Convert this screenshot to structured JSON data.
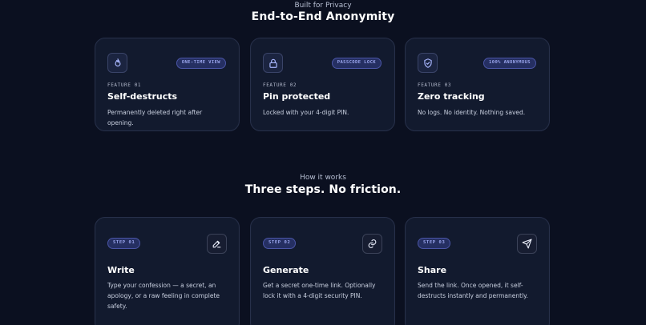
{
  "section1": {
    "eyebrow": "Built for Privacy",
    "title": "End-to-End Anonymity",
    "features": [
      {
        "icon": "flame-icon",
        "badge": "ONE-TIME VIEW",
        "label": "FEATURE 01",
        "title": "Self-destructs",
        "description": "Permanently deleted right after opening."
      },
      {
        "icon": "lock-icon",
        "badge": "PASSCODE LOCK",
        "label": "FEATURE 02",
        "title": "Pin protected",
        "description": "Locked with your 4-digit PIN."
      },
      {
        "icon": "shield-check-icon",
        "badge": "100% ANONYMOUS",
        "label": "FEATURE 03",
        "title": "Zero tracking",
        "description": "No logs. No identity. Nothing saved."
      }
    ]
  },
  "section2": {
    "eyebrow": "How it works",
    "title": "Three steps. No friction.",
    "steps": [
      {
        "badge": "STEP 01",
        "icon": "pencil-icon",
        "title": "Write",
        "description": "Type your confession — a secret, an apology, or a raw feeling in complete safety."
      },
      {
        "badge": "STEP 02",
        "icon": "link-icon",
        "title": "Generate",
        "description": "Get a secret one-time link. Optionally lock it with a 4-digit security PIN."
      },
      {
        "badge": "STEP 03",
        "icon": "send-icon",
        "title": "Share",
        "description": "Send the link. Once opened, it self-destructs instantly and permanently."
      }
    ]
  },
  "colors": {
    "background": "#0b1020",
    "card": "#121a2e",
    "border": "#27304a",
    "accent": "#9ca7ef"
  }
}
